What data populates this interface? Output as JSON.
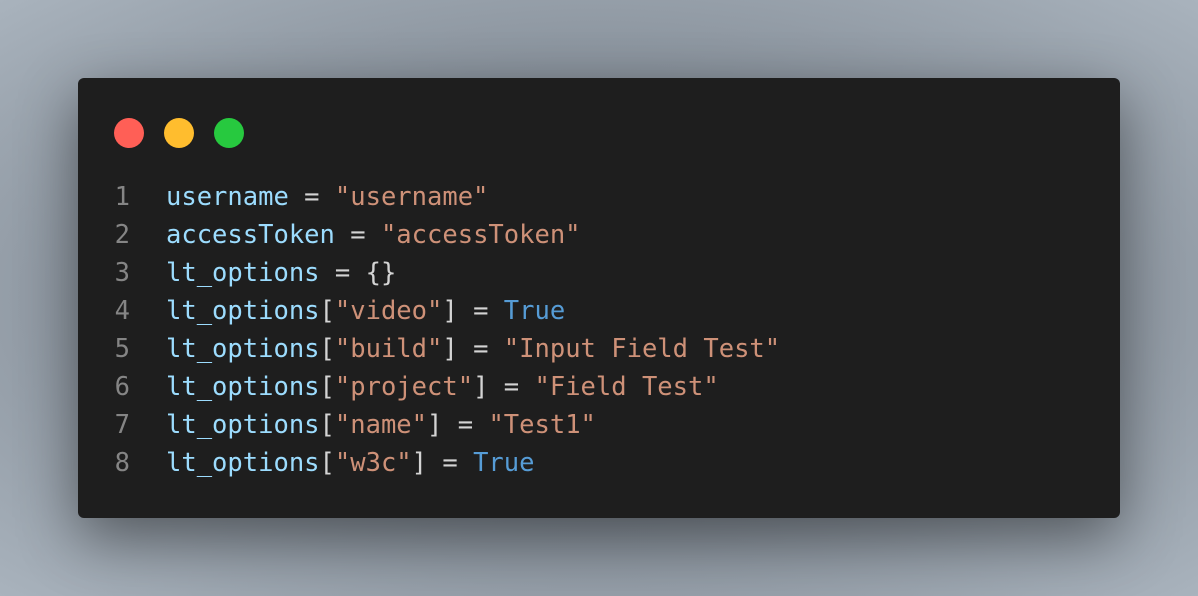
{
  "window": {
    "buttons": [
      {
        "name": "close",
        "color": "#ff5f56"
      },
      {
        "name": "minimize",
        "color": "#ffbd2e"
      },
      {
        "name": "maximize",
        "color": "#27c93f"
      }
    ]
  },
  "code": {
    "language": "python",
    "lines": [
      {
        "number": "1",
        "tokens": [
          {
            "t": "var",
            "v": "username"
          },
          {
            "t": "op",
            "v": " = "
          },
          {
            "t": "str",
            "v": "\"username\""
          }
        ]
      },
      {
        "number": "2",
        "tokens": [
          {
            "t": "var",
            "v": "accessToken"
          },
          {
            "t": "op",
            "v": " = "
          },
          {
            "t": "str",
            "v": "\"accessToken\""
          }
        ]
      },
      {
        "number": "3",
        "tokens": [
          {
            "t": "var",
            "v": "lt_options"
          },
          {
            "t": "op",
            "v": " = {}"
          }
        ]
      },
      {
        "number": "4",
        "tokens": [
          {
            "t": "var",
            "v": "lt_options"
          },
          {
            "t": "op",
            "v": "["
          },
          {
            "t": "str",
            "v": "\"video\""
          },
          {
            "t": "op",
            "v": "] = "
          },
          {
            "t": "kw",
            "v": "True"
          }
        ]
      },
      {
        "number": "5",
        "tokens": [
          {
            "t": "var",
            "v": "lt_options"
          },
          {
            "t": "op",
            "v": "["
          },
          {
            "t": "str",
            "v": "\"build\""
          },
          {
            "t": "op",
            "v": "] = "
          },
          {
            "t": "str",
            "v": "\"Input Field Test\""
          }
        ]
      },
      {
        "number": "6",
        "tokens": [
          {
            "t": "var",
            "v": "lt_options"
          },
          {
            "t": "op",
            "v": "["
          },
          {
            "t": "str",
            "v": "\"project\""
          },
          {
            "t": "op",
            "v": "] = "
          },
          {
            "t": "str",
            "v": "\"Field Test\""
          }
        ]
      },
      {
        "number": "7",
        "tokens": [
          {
            "t": "var",
            "v": "lt_options"
          },
          {
            "t": "op",
            "v": "["
          },
          {
            "t": "str",
            "v": "\"name\""
          },
          {
            "t": "op",
            "v": "] = "
          },
          {
            "t": "str",
            "v": "\"Test1\""
          }
        ]
      },
      {
        "number": "8",
        "tokens": [
          {
            "t": "var",
            "v": "lt_options"
          },
          {
            "t": "op",
            "v": "["
          },
          {
            "t": "str",
            "v": "\"w3c\""
          },
          {
            "t": "op",
            "v": "] = "
          },
          {
            "t": "kw",
            "v": "True"
          }
        ]
      }
    ]
  }
}
